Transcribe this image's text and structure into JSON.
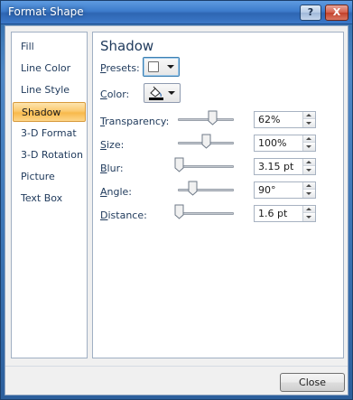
{
  "window": {
    "title": "Format Shape",
    "help_label": "?",
    "close_label": "X"
  },
  "nav": {
    "items": [
      {
        "label": "Fill"
      },
      {
        "label": "Line Color"
      },
      {
        "label": "Line Style"
      },
      {
        "label": "Shadow",
        "selected": true
      },
      {
        "label": "3-D Format"
      },
      {
        "label": "3-D Rotation"
      },
      {
        "label": "Picture"
      },
      {
        "label": "Text Box"
      }
    ]
  },
  "shadow": {
    "section_title": "Shadow",
    "presets": {
      "label_accel": "P",
      "label_rest": "resets:"
    },
    "color": {
      "label_accel": "C",
      "label_rest": "olor:",
      "color": "#000000"
    },
    "transparency": {
      "label_accel": "T",
      "label_rest": "ransparency:",
      "value": "62%",
      "level": 0.62
    },
    "size": {
      "label_accel": "S",
      "label_rest": "ize:",
      "value": "100%",
      "level": 0.5
    },
    "blur": {
      "label_accel": "B",
      "label_rest": "lur:",
      "value": "3.15 pt",
      "level": 0.0
    },
    "angle": {
      "label_accel": "A",
      "label_rest": "ngle:",
      "value": "90°",
      "level": 0.25
    },
    "distance": {
      "label_accel": "D",
      "label_rest": "istance:",
      "value": "1.6 pt",
      "level": 0.0
    }
  },
  "footer": {
    "close_label": "Close"
  },
  "colors": {
    "selected_item": "#f8b94c",
    "text": "#1e395b",
    "title_bar": "#3d7ccc"
  }
}
